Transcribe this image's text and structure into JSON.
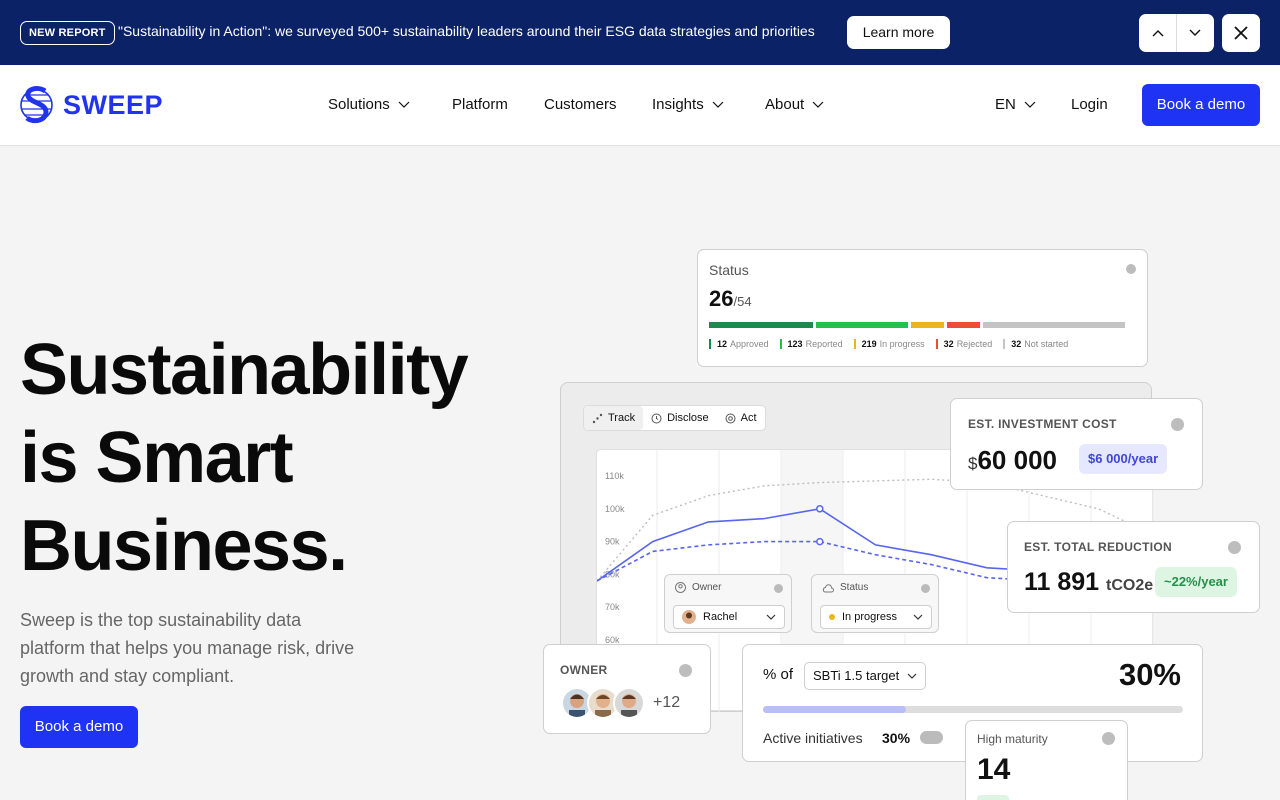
{
  "banner": {
    "badge": "NEW REPORT",
    "text": "\"Sustainability in Action\": we surveyed 500+ sustainability leaders around their ESG data strategies and priorities",
    "cta": "Learn more"
  },
  "header": {
    "brand": "SWEEP",
    "nav": [
      {
        "label": "Solutions",
        "dropdown": true
      },
      {
        "label": "Platform",
        "dropdown": false
      },
      {
        "label": "Customers",
        "dropdown": false
      },
      {
        "label": "Insights",
        "dropdown": true
      },
      {
        "label": "About",
        "dropdown": true
      }
    ],
    "language": "EN",
    "login": "Login",
    "cta": "Book a demo"
  },
  "hero": {
    "title_lines": [
      "Sustainability",
      "is Smart",
      "Business."
    ],
    "subtitle": "Sweep is the top sustainability data platform that helps you manage risk, drive growth and stay compliant.",
    "cta": "Book a demo"
  },
  "status_card": {
    "label": "Status",
    "value": "26",
    "total": "/54",
    "legend": [
      {
        "count": "12",
        "label": "Approved",
        "color": "#1a8a4f"
      },
      {
        "count": "123",
        "label": "Reported",
        "color": "#22c24a"
      },
      {
        "count": "219",
        "label": "In progress",
        "color": "#e8b71c"
      },
      {
        "count": "32",
        "label": "Rejected",
        "color": "#ee4c34"
      },
      {
        "count": "32",
        "label": "Not started",
        "color": "#c4c4c4"
      }
    ],
    "bar_fractions": [
      0.25,
      0.22,
      0.08,
      0.08,
      0.34
    ]
  },
  "chart_panel": {
    "tabs": [
      {
        "label": "Track",
        "active": true
      },
      {
        "label": "Disclose",
        "active": false
      },
      {
        "label": "Act",
        "active": false
      }
    ],
    "y_ticks": [
      "110k",
      "100k",
      "90k",
      "80k",
      "70k",
      "60k"
    ],
    "owner_card": {
      "title": "Owner",
      "value": "Rachel"
    },
    "status_card": {
      "title": "Status",
      "value": "In progress"
    }
  },
  "chart_data": {
    "type": "line",
    "y_ticks": [
      "110k",
      "100k",
      "90k",
      "80k",
      "70k",
      "60k"
    ],
    "ylim": [
      60000,
      110000
    ],
    "series": [
      {
        "style": "dotted-gray",
        "values": [
          78000,
          98000,
          104000,
          107000,
          108000,
          108500,
          109000,
          108000,
          104000,
          100000,
          92000
        ]
      },
      {
        "style": "solid-blue",
        "values": [
          78000,
          90000,
          96000,
          97000,
          100000,
          89000,
          86000,
          82000,
          81000,
          79000,
          74000
        ]
      },
      {
        "style": "dashed-blue",
        "values": [
          78000,
          87000,
          89000,
          90000,
          90000,
          86000,
          83000,
          79000,
          78000,
          77000,
          72000
        ]
      }
    ]
  },
  "investment_card": {
    "caption": "EST. INVESTMENT COST",
    "currency": "$",
    "value": "60 000",
    "pill": "$6 000/year"
  },
  "reduction_card": {
    "caption": "EST. TOTAL REDUCTION",
    "value": "11 891",
    "unit": "tCO2e",
    "pill": "~22%/year"
  },
  "owner_card": {
    "caption": "OWNER",
    "extra": "+12"
  },
  "sbti_card": {
    "prefix": "% of",
    "target": "SBTi 1.5 target",
    "value": "30%",
    "progress": 0.34,
    "active_label": "Active initiatives",
    "active_value": "30%"
  },
  "maturity_card": {
    "label": "High maturity",
    "value": "14"
  },
  "colors": {
    "brand": "#1f33f5",
    "banner_bg": "#0b2267",
    "chart_line": "#5865ee"
  }
}
